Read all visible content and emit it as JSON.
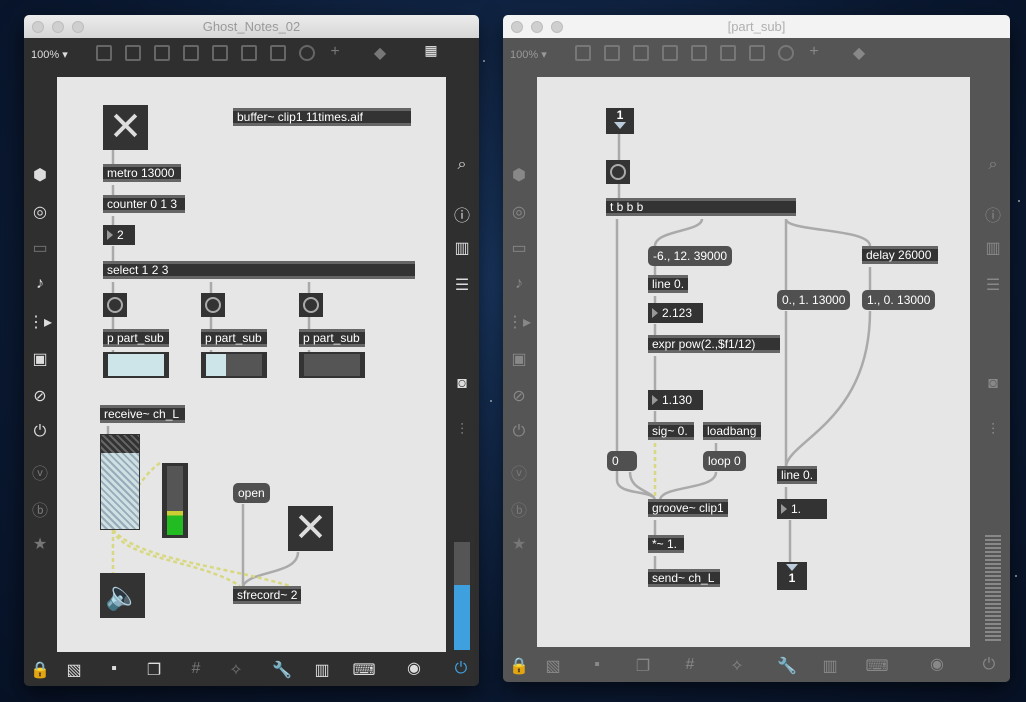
{
  "left_window": {
    "title": "Ghost_Notes_02",
    "zoom": "100%",
    "objects": {
      "buffer": "buffer~ clip1 11times.aif",
      "metro": "metro 13000",
      "counter": "counter 0 1 3",
      "counter_out": "2",
      "select": "select 1 2 3",
      "p1": "p part_sub",
      "p2": "p part_sub",
      "p3": "p part_sub",
      "receive": "receive~ ch_L",
      "open": "open",
      "sfrecord": "sfrecord~ 2"
    }
  },
  "right_window": {
    "title": "[part_sub]",
    "zoom": "100%",
    "objects": {
      "inlet_num": "1",
      "trigger": "t b b b",
      "msg_pitch": "-6., 12. 39000",
      "delay": "delay 26000",
      "line1": "line 0.",
      "msg_fadein": "0., 1. 13000",
      "msg_fadeout": "1., 0. 13000",
      "num_pitch": "2.123",
      "expr": "expr pow(2.,$f1/12)",
      "num_rate": "1.130",
      "sig": "sig~ 0.",
      "loadbang": "loadbang",
      "msg_zero": "0",
      "loop": "loop 0",
      "line2": "line 0.",
      "groove": "groove~ clip1",
      "num_gain": "1.",
      "mul": "*~ 1.",
      "send": "send~ ch_L",
      "outlet_num": "1"
    }
  }
}
